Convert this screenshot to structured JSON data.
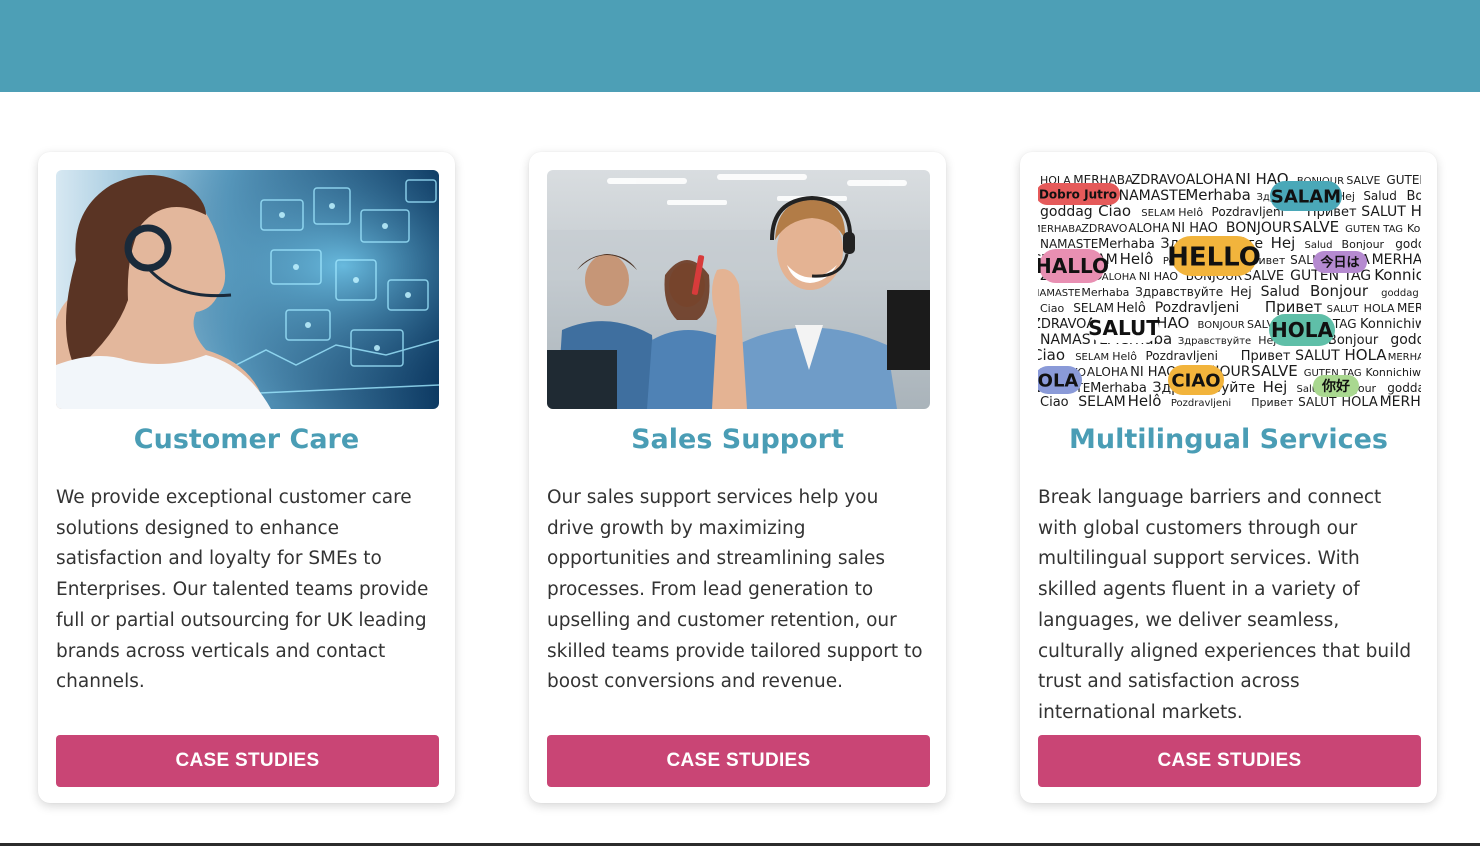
{
  "cards": [
    {
      "title": "Customer Care",
      "text": "We provide exceptional customer care solutions designed to enhance satisfaction and loyalty for SMEs to Enterprises. Our talented teams provide full or partial outsourcing for UK leading brands across verticals and contact channels.",
      "button_label": "CASE STUDIES"
    },
    {
      "title": "Sales Support",
      "text": "Our sales support services help you drive growth by maximizing opportunities and streamlining sales processes. From lead generation to upselling and customer retention, our skilled teams provide tailored support to boost conversions and revenue.",
      "button_label": "CASE STUDIES"
    },
    {
      "title": "Multilingual Services",
      "text": "Break language barriers and connect with global customers through our multilingual support services. With skilled agents fluent in a variety of languages, we deliver seamless, culturally aligned experiences that build trust and satisfaction across international markets.",
      "button_label": "CASE STUDIES"
    }
  ],
  "colors": {
    "header_band": "#4d9fb6",
    "title": "#4a9db5",
    "button": "#c94575"
  },
  "multilingual_words": {
    "bubbles": [
      "Dobro Jutro",
      "SALAM",
      "HELLO",
      "HALLO",
      "SALUT",
      "HOLA",
      "OLA",
      "CIAO",
      "今日は",
      "你好"
    ],
    "plain": [
      "HOLA",
      "MERHABA",
      "ZDRAVO",
      "ALOHA",
      "NI HAO",
      "BONJOUR",
      "SALVE",
      "GUTEN TAG",
      "Konnichiwa",
      "NAMASTE",
      "Merhaba",
      "Здравствуйте",
      "Hej",
      "Salud",
      "Bonjour",
      "goddag",
      "Ciao",
      "SELAM",
      "Helô",
      "Pozdravljeni",
      "Привет",
      "SALUT"
    ]
  }
}
